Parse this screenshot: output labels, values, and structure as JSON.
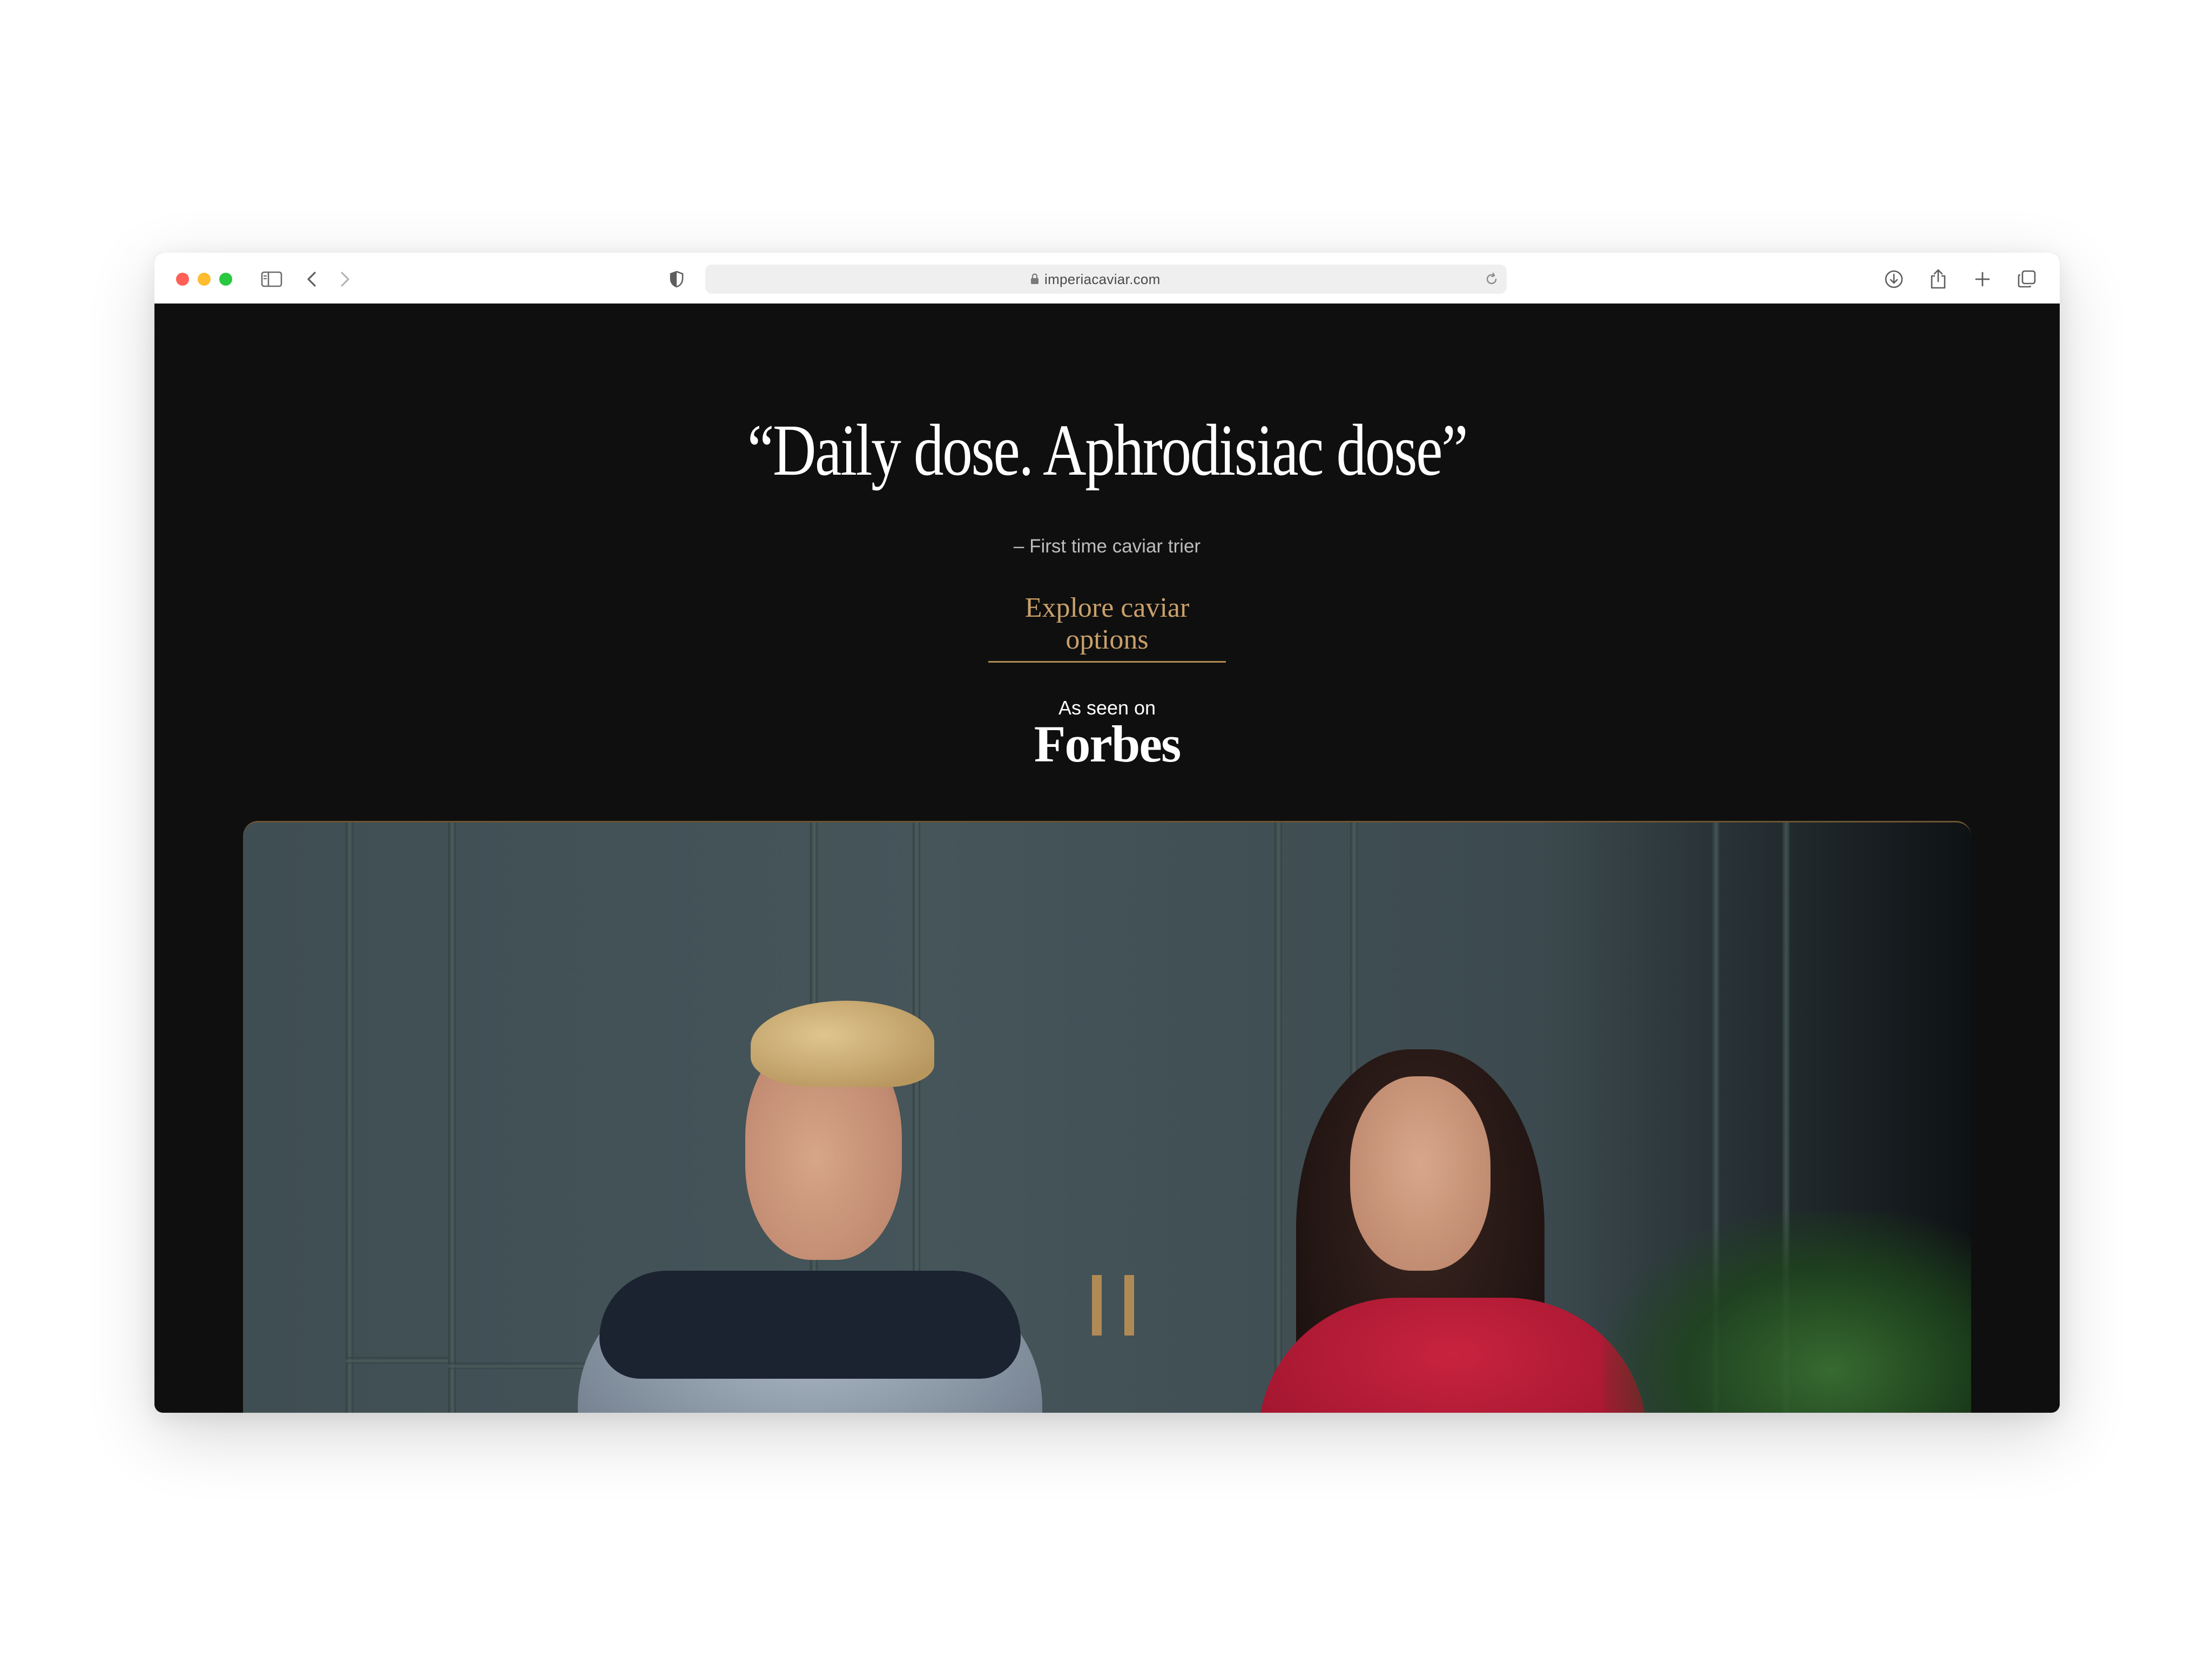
{
  "browser": {
    "url": "imperiacaviar.com"
  },
  "hero": {
    "quote": "“Daily dose. Aphrodisiac dose”",
    "attribution": "– First time caviar trier",
    "cta_label": "Explore  caviar options"
  },
  "press": {
    "label": "As seen on",
    "outlet": "Forbes"
  },
  "colors": {
    "page_bg": "#0f0f0f",
    "accent_gold": "#c9a06a",
    "text_primary": "#ffffff"
  }
}
